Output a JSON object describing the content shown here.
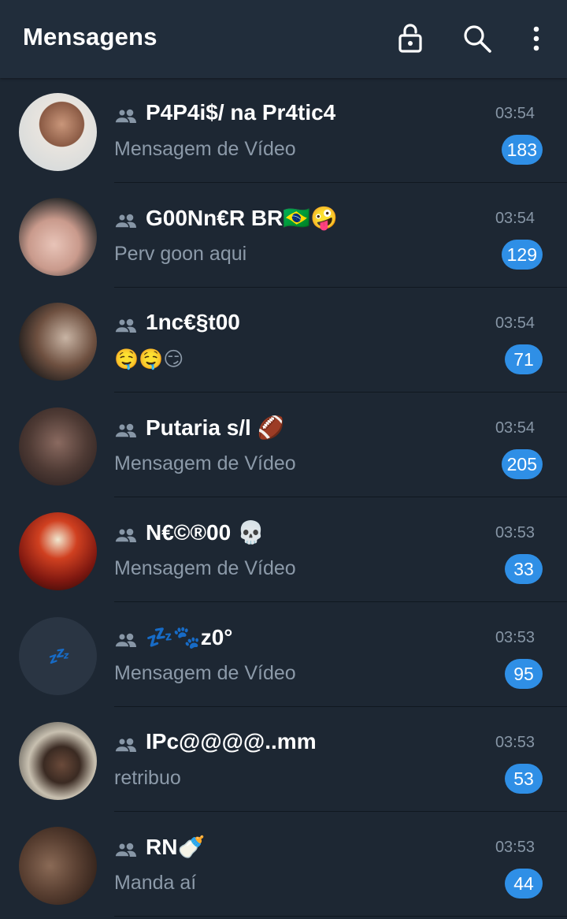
{
  "header": {
    "title": "Mensagens",
    "icons": [
      "lock-open-icon",
      "search-icon",
      "more-vert-icon"
    ]
  },
  "colors": {
    "background": "#1d2733",
    "appbar": "#212d3b",
    "accent": "#2f8fe6",
    "secondary_text": "#8c9aa9"
  },
  "chats": [
    {
      "name": "P4P4i$/ na Pr4tic4",
      "time": "03:54",
      "preview": "Mensagem de Vídeo",
      "unread": "183",
      "avatar": "photo"
    },
    {
      "name": "G00Nn€R BR🇧🇷🤪",
      "time": "03:54",
      "preview": "Perv goon aqui",
      "unread": "129",
      "avatar": "photo"
    },
    {
      "name": "1nc€§t00",
      "time": "03:54",
      "preview": "🤤🤤😏",
      "unread": "71",
      "avatar": "photo"
    },
    {
      "name": "Putaria s/l 🏈",
      "time": "03:54",
      "preview": "Mensagem de Vídeo",
      "unread": "205",
      "avatar": "photo"
    },
    {
      "name": "N€©®00 💀",
      "time": "03:53",
      "preview": "Mensagem de Vídeo",
      "unread": "33",
      "avatar": "photo"
    },
    {
      "name": "💤🐾z0°",
      "time": "03:53",
      "preview": "Mensagem de Vídeo",
      "unread": "95",
      "avatar": "💤"
    },
    {
      "name": "IPc@@@@..mm",
      "time": "03:53",
      "preview": "retribuo",
      "unread": "53",
      "avatar": "photo"
    },
    {
      "name": "RN🍼",
      "time": "03:53",
      "preview": "Manda aí",
      "unread": "44",
      "avatar": "photo"
    }
  ]
}
